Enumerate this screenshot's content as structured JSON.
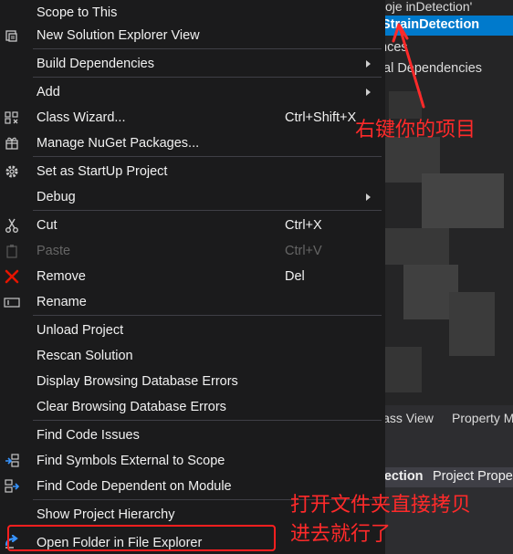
{
  "menu": {
    "items": [
      {
        "label": "Scope to This"
      },
      {
        "label": "New Solution Explorer View",
        "icon": "new-view-icon"
      },
      {
        "label": "Build Dependencies",
        "submenu": true
      },
      {
        "label": "Add",
        "submenu": true
      },
      {
        "label": "Class Wizard...",
        "shortcut": "Ctrl+Shift+X",
        "icon": "class-wizard-icon"
      },
      {
        "label": "Manage NuGet Packages...",
        "icon": "nuget-package-icon"
      },
      {
        "label": "Set as StartUp Project",
        "icon": "gear-icon"
      },
      {
        "label": "Debug",
        "submenu": true
      },
      {
        "label": "Cut",
        "shortcut": "Ctrl+X",
        "icon": "scissors-icon"
      },
      {
        "label": "Paste",
        "shortcut": "Ctrl+V",
        "icon": "paste-icon",
        "disabled": true
      },
      {
        "label": "Remove",
        "shortcut": "Del",
        "icon": "remove-x-icon"
      },
      {
        "label": "Rename",
        "icon": "rename-icon"
      },
      {
        "label": "Unload Project"
      },
      {
        "label": "Rescan Solution"
      },
      {
        "label": "Display Browsing Database Errors"
      },
      {
        "label": "Clear Browsing Database Errors"
      },
      {
        "label": "Find Code Issues"
      },
      {
        "label": "Find Symbols External to Scope",
        "icon": "find-symbols-icon"
      },
      {
        "label": "Find Code Dependent on Module",
        "icon": "find-dependent-icon"
      },
      {
        "label": "Show Project Hierarchy"
      },
      {
        "label": "Open Folder in File Explorer",
        "icon": "open-folder-arrow-icon"
      }
    ]
  },
  "solution_explorer": {
    "title_fragment": "oje     inDetection'",
    "selected_item": "StrainDetection",
    "rows": [
      "nces",
      "al Dependencies"
    ],
    "tabs": [
      "lass View",
      "Property M"
    ],
    "properties_title_bold": "tection",
    "properties_title_rest": "Project Prope"
  },
  "annotations": {
    "top_note": "右键你的项目",
    "bottom_note_line1": "打开文件夹直接拷贝",
    "bottom_note_line2": "进去就行了"
  },
  "colors": {
    "menu_bg": "#1b1b1c",
    "selection_blue": "#007acc",
    "annotation_red": "#ff2a2a"
  }
}
